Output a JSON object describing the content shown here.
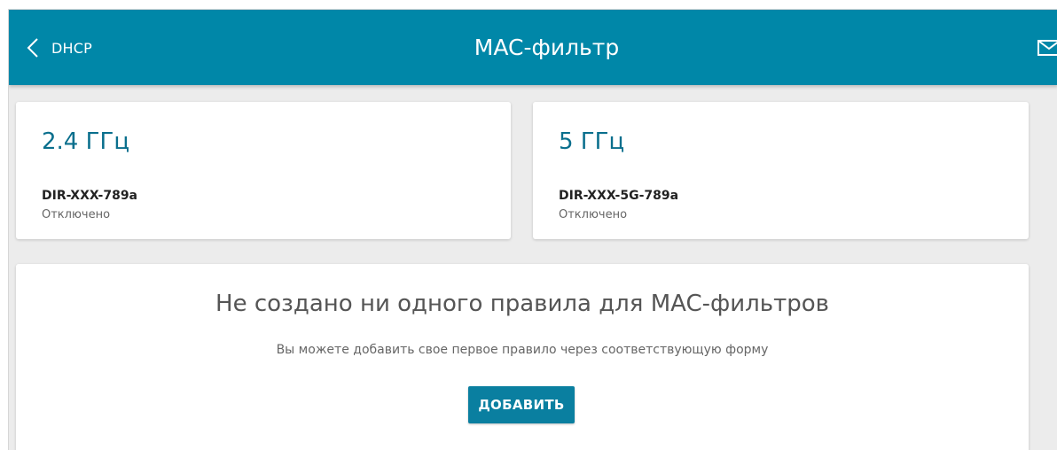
{
  "header": {
    "back_label": "DHCP",
    "title": "MAC-фильтр",
    "icons": [
      "chevron-left-icon",
      "mail-icon"
    ]
  },
  "bands": [
    {
      "title": "2.4 ГГц",
      "ssid": "DIR-XXX-789a",
      "status": "Отключено"
    },
    {
      "title": "5 ГГц",
      "ssid": "DIR-XXX-5G-789a",
      "status": "Отключено"
    }
  ],
  "empty_state": {
    "title": "Не создано ни одного правила для MAC-фильтров",
    "subtitle": "Вы можете добавить свое первое правило через соответствующую форму",
    "add_button": "ДОБАВИТЬ"
  },
  "colors": {
    "header": "#0087a8",
    "accent_text": "#0a6f8d",
    "button": "#0a7fa0",
    "background": "#ececec"
  }
}
